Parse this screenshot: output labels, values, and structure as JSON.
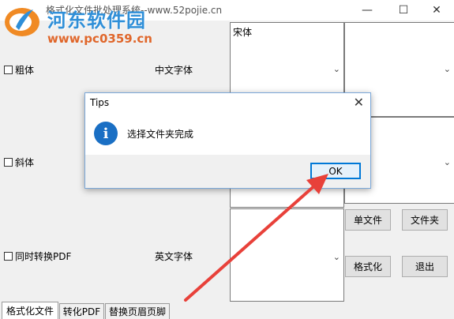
{
  "window": {
    "title": "格式化文件批处理系统--www.52pojie.cn",
    "min_glyph": "—",
    "max_glyph": "☐",
    "close_glyph": "✕"
  },
  "watermark": {
    "name": "河东软件园",
    "url": "www.pc0359.cn"
  },
  "options": {
    "bold_label": "粗体",
    "italic_label": "斜体",
    "pdf_label": "同时转换PDF"
  },
  "fonts": {
    "chinese_label": "中文字体",
    "english_label": "英文字体",
    "chinese_value": "宋体"
  },
  "buttons": {
    "single_file": "单文件",
    "folder": "文件夹",
    "format": "格式化",
    "exit": "退出"
  },
  "tabs": [
    {
      "label": "格式化文件"
    },
    {
      "label": "转化PDF"
    },
    {
      "label": "替换页眉页脚"
    }
  ],
  "dialog": {
    "title": "Tips",
    "message": "选择文件夹完成",
    "ok_label": "OK",
    "close_glyph": "✕",
    "icon_glyph": "i"
  },
  "colors": {
    "accent": "#0078d7",
    "arrow": "#e8413a"
  }
}
